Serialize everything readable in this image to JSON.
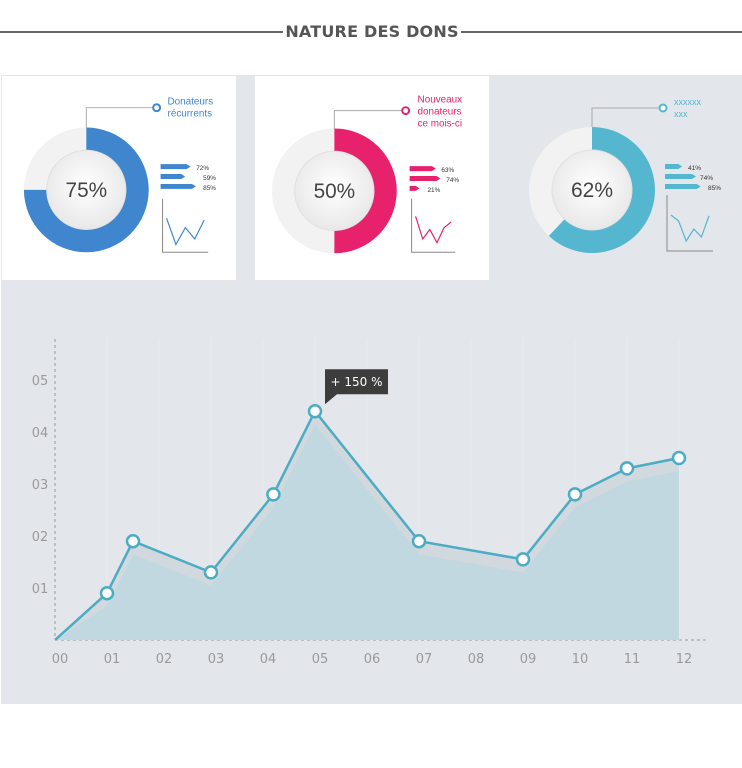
{
  "header": {
    "title": "NATURE DES DONS"
  },
  "cards": [
    {
      "percent": "75%",
      "percent_value": 75,
      "label_lines": [
        "Donateurs",
        "récurrents"
      ],
      "color": "#3f86ce",
      "bars": [
        {
          "value": 72,
          "label": "72%"
        },
        {
          "value": 59,
          "label": "59%"
        },
        {
          "value": 85,
          "label": "85%"
        }
      ],
      "sparkline": [
        0.8,
        0.1,
        0.55,
        0.25,
        0.75
      ]
    },
    {
      "percent": "50%",
      "percent_value": 50,
      "label_lines": [
        "Nouveaux",
        "donateurs",
        "ce mois-ci"
      ],
      "color": "#e8216d",
      "bars": [
        {
          "value": 63,
          "label": "63%"
        },
        {
          "value": 74,
          "label": "74%"
        },
        {
          "value": 21,
          "label": "21%"
        }
      ],
      "sparkline": [
        0.85,
        0.25,
        0.5,
        0.15,
        0.55,
        0.7
      ]
    },
    {
      "percent": "62%",
      "percent_value": 62,
      "label_lines": [
        "xxxxxx",
        "xxx"
      ],
      "color": "#55b7cf",
      "bars": [
        {
          "value": 41,
          "label": "41%"
        },
        {
          "value": 74,
          "label": "74%"
        },
        {
          "value": 85,
          "label": "85%"
        }
      ],
      "sparkline": [
        0.8,
        0.65,
        0.15,
        0.45,
        0.25,
        0.78
      ]
    }
  ],
  "chart_data": {
    "type": "area",
    "x": [
      "00",
      "01",
      "01.5",
      "03",
      "04",
      "05",
      "07",
      "09",
      "10",
      "11",
      "12"
    ],
    "x_values": [
      0,
      1,
      1.5,
      3.0,
      4.2,
      5.0,
      7.0,
      9.0,
      10.0,
      11.0,
      12.0
    ],
    "values": [
      0,
      0.9,
      1.9,
      1.3,
      2.8,
      4.4,
      1.9,
      1.55,
      2.8,
      3.3,
      3.5
    ],
    "xlabels": [
      "00",
      "01",
      "02",
      "03",
      "04",
      "05",
      "06",
      "07",
      "08",
      "09",
      "10",
      "11",
      "12"
    ],
    "ylabels": [
      "01",
      "02",
      "03",
      "04",
      "05"
    ],
    "xlim": [
      0,
      12
    ],
    "ylim": [
      0,
      6
    ],
    "annotation": {
      "text": "+ 150 %",
      "point_index": 5
    },
    "line_color": "#4cacc4",
    "area_color": "#c1d8e1"
  }
}
